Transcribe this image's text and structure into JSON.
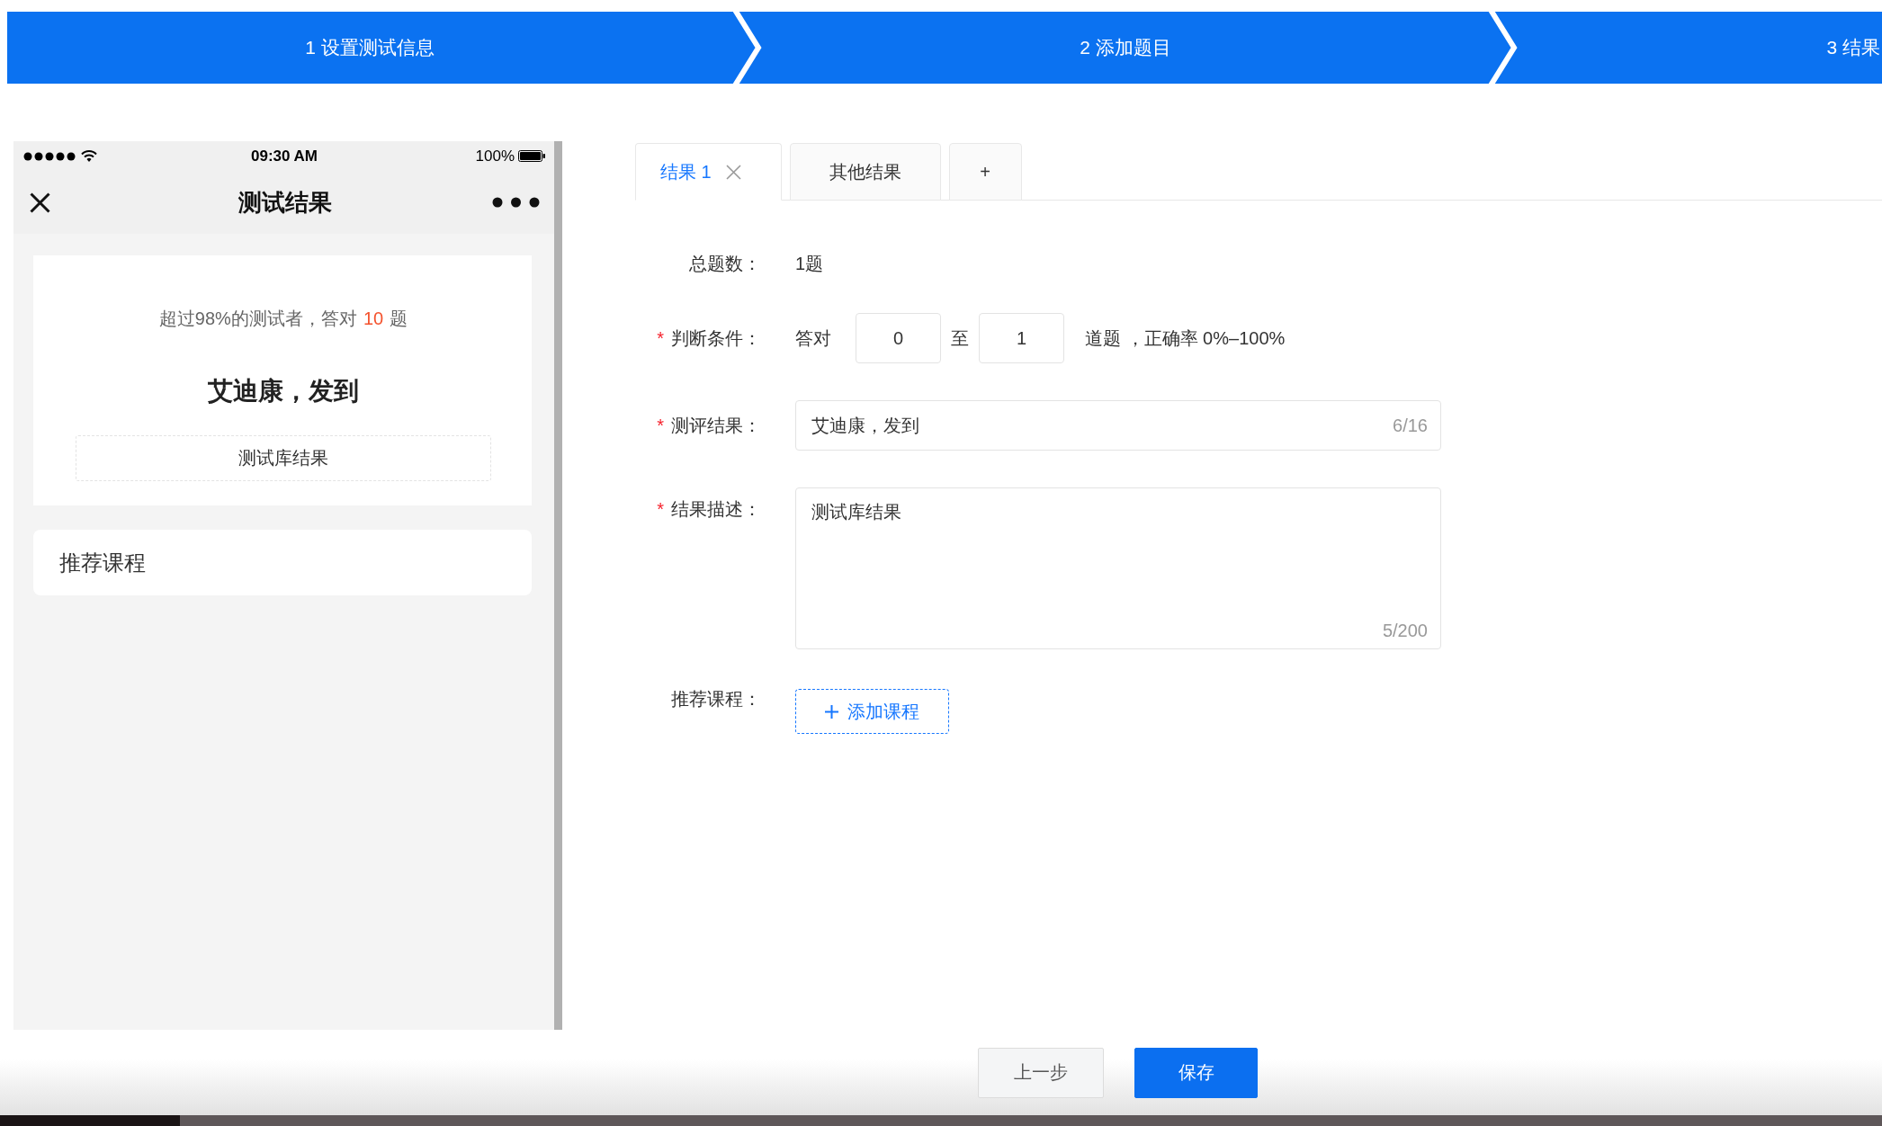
{
  "steps": [
    {
      "label": "1 设置测试信息"
    },
    {
      "label": "2 添加题目"
    },
    {
      "label": "3 结果"
    }
  ],
  "phone_preview": {
    "status_bar": {
      "time": "09:30 AM",
      "battery": "100%"
    },
    "title": "测试结果",
    "summary": {
      "text_before": "超过98%的测试者，答对",
      "highlight": "10",
      "text_after": "题"
    },
    "result_title": "艾迪康，发到",
    "result_description": "测试库结果",
    "recommend_title": "推荐课程"
  },
  "tabs": [
    {
      "kind": "tab",
      "label": "结果 1",
      "selected": true,
      "closable": true
    },
    {
      "kind": "tab",
      "label": "其他结果",
      "selected": false,
      "closable": false
    },
    {
      "kind": "add",
      "label": "+",
      "selected": false
    }
  ],
  "form": {
    "rows": [
      {
        "kind": "text",
        "label": "总题数：",
        "value": "1题"
      },
      {
        "kind": "range",
        "mark": "*",
        "label": "判断条件：",
        "prefix": "答对",
        "from": "0",
        "separator": "至",
        "to": "1",
        "suffix": "道题 ，正确率 0%–100%"
      },
      {
        "kind": "input",
        "mark": "*",
        "label": "测评结果：",
        "value": "艾迪康，发到",
        "counter": "6/16"
      },
      {
        "kind": "textarea",
        "mark": "*",
        "label": "结果描述：",
        "value": "测试库结果",
        "counter": "5/200"
      },
      {
        "kind": "button",
        "label": "推荐课程：",
        "button": "添加课程"
      }
    ]
  },
  "footer_buttons": [
    {
      "kind": "secondary",
      "label": "上一步"
    },
    {
      "kind": "primary",
      "label": "保存"
    }
  ]
}
